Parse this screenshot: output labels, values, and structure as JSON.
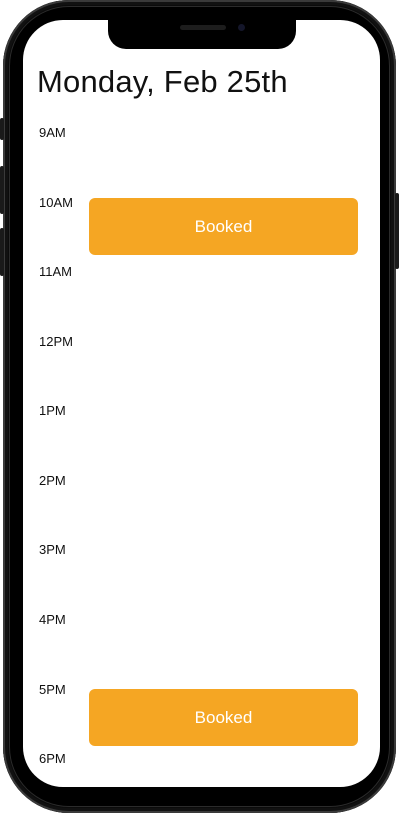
{
  "header": {
    "date_title": "Monday, Feb 25th"
  },
  "timeline": {
    "hours": [
      "9AM",
      "10AM",
      "11AM",
      "12PM",
      "1PM",
      "2PM",
      "3PM",
      "4PM",
      "5PM",
      "6PM"
    ]
  },
  "events": [
    {
      "label": "Booked",
      "color": "#f5a623"
    },
    {
      "label": "Booked",
      "color": "#f5a623"
    }
  ]
}
